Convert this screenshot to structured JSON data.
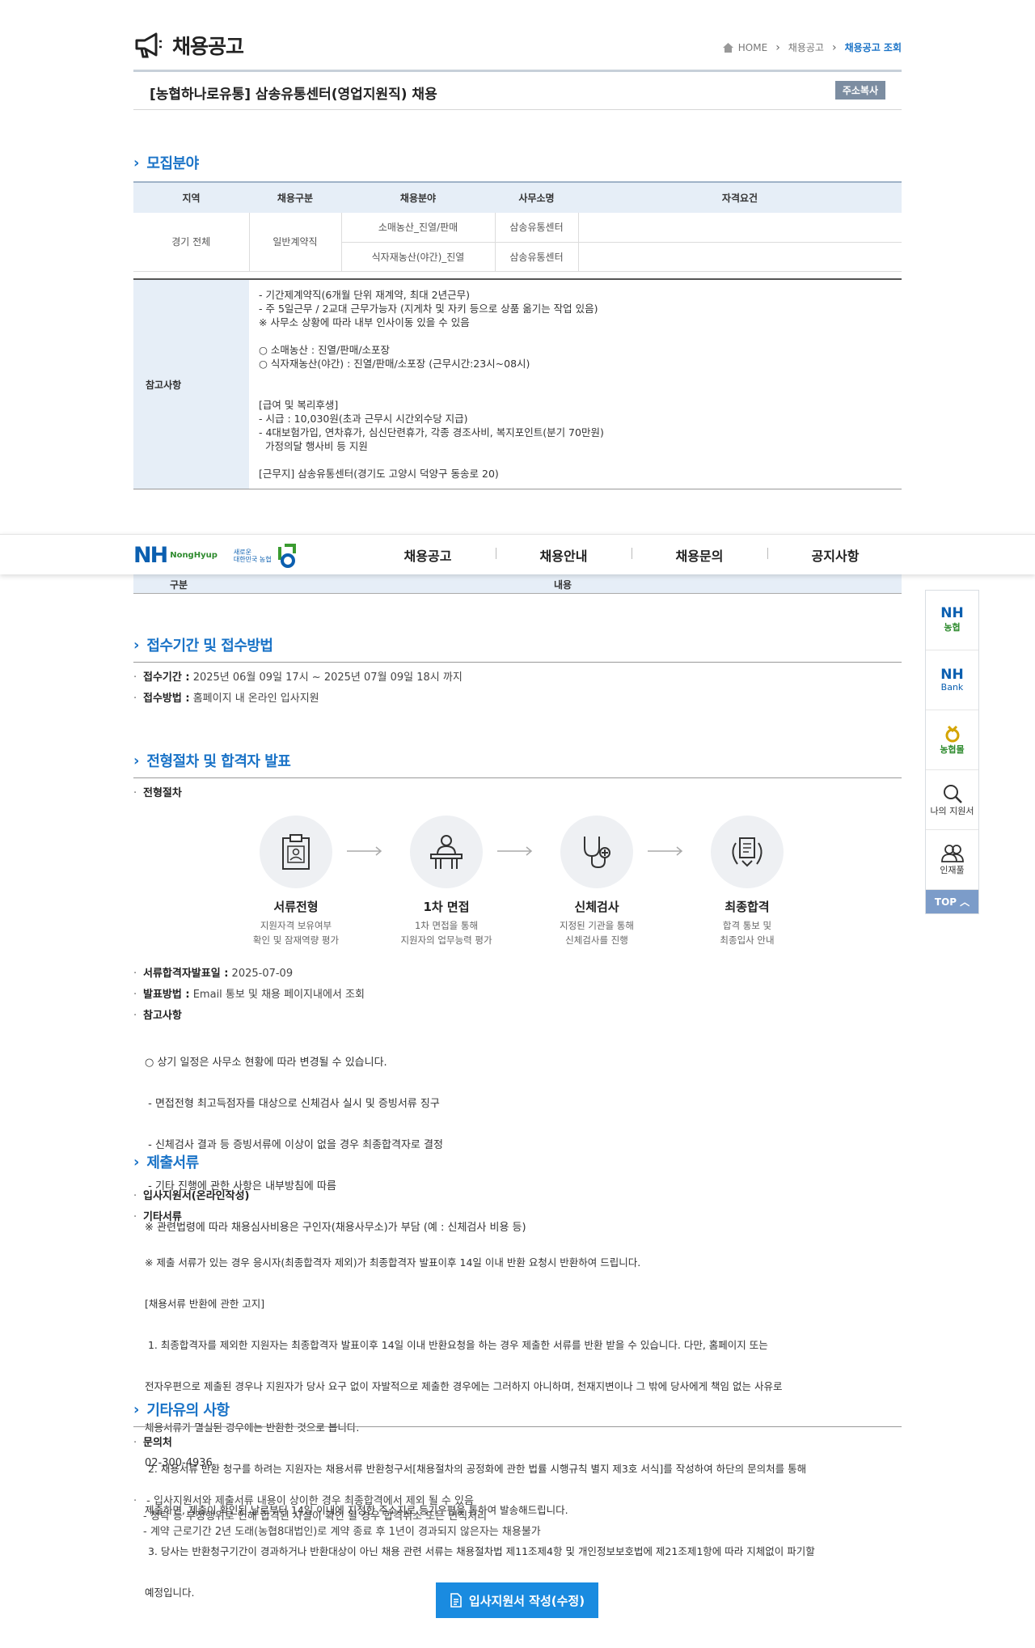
{
  "header": {
    "title": "채용공고",
    "breadcrumb": [
      "HOME",
      "채용공고",
      "채용공고 조회"
    ]
  },
  "job": {
    "title": "[농협하나로유통] 삼송유통센터(영업지원직) 채용",
    "copy_label": "주소복사"
  },
  "recruit": {
    "section_title": "모집분야",
    "columns": [
      "지역",
      "채용구분",
      "채용분야",
      "사무소명",
      "자격요건"
    ],
    "region": "경기 전체",
    "type": "일반계약직",
    "rows": [
      {
        "field": "소매농산_진열/판매",
        "office": "삼송유통센터",
        "qual": ""
      },
      {
        "field": "식자재농산(야간)_진열",
        "office": "삼송유통센터",
        "qual": ""
      }
    ]
  },
  "notes": {
    "label": "참고사항",
    "lines": [
      "- 기간제계약직(6개월 단위 재계약, 최대 2년근무)",
      "- 주 5일근무 / 2교대 근무가능자 (지게차 및 자키 등으로 상품 옮기는 작업 있음)",
      "※ 사무소 상황에 따라 내부 인사이동 있을 수 있음",
      "",
      "○ 소매농산 : 진열/판매/소포장",
      "○ 식자재농산(야간) : 진열/판매/소포장 (근무시간:23시~08시)",
      "",
      "",
      "[급여 및 복리후생]",
      "- 시급 : 10,030원(초과 근무시 시간외수당 지급)",
      "- 4대보험가입, 연차휴가, 심신단련휴가, 각종 경조사비, 복지포인트(분기 70만원)",
      "  가정의달 행사비 등 지원",
      "",
      "[근무지] 삼송유통센터(경기도 고양시 덕양구 동송로 20)"
    ]
  },
  "nav": {
    "logo": "NH",
    "logo_sub": "NongHyup",
    "slogan_1": "새로운",
    "slogan_2": "대한민국 농협",
    "menu": [
      "채용공고",
      "채용안내",
      "채용문의",
      "공지사항"
    ],
    "hidden_left": "구분",
    "hidden_right": "내용"
  },
  "reception": {
    "section_title": "접수기간 및 접수방법",
    "period_label": "접수기간 :",
    "period": "2025년 06월 09일 17시 ~ 2025년 07월 09일 18시 까지",
    "method_label": "접수방법 :",
    "method": "홈페이지 내 온라인 입사지원"
  },
  "process": {
    "section_title": "전형절차 및 합격자 발표",
    "label": "전형절차",
    "steps": [
      {
        "name": "서류전형",
        "desc1": "지원자격 보유여부",
        "desc2": "확인 및 잠재역량 평가"
      },
      {
        "name": "1차 면접",
        "desc1": "1차 면접을 통해",
        "desc2": "지원자의 업무능력 평가"
      },
      {
        "name": "신체검사",
        "desc1": "지정된 기관을 통해",
        "desc2": "신체검사를 진행"
      },
      {
        "name": "최종합격",
        "desc1": "합격 통보 및",
        "desc2": "최종입사 안내"
      }
    ],
    "announce_label": "서류합격자발표일 :",
    "announce": "2025-07-09",
    "method_label": "발표방법 :",
    "method": "Email 통보 및 채용 페이지내에서 조회",
    "notes_label": "참고사항",
    "notes": [
      "○ 상기 일정은 사무소 현황에 따라 변경될 수 있습니다.",
      " - 면접전형 최고득점자를 대상으로 신체검사 실시 및 증빙서류 징구",
      " - 신체검사 결과 등 증빙서류에 이상이 없을 경우 최종합격자로 결정",
      " - 기타 진행에 관한 사항은 내부방침에 따름",
      "※ 관련법령에 따라 채용심사비용은 구인자(채용사무소)가 부담 (예 : 신체검사 비용 등)"
    ]
  },
  "documents": {
    "section_title": "제출서류",
    "item1": "입사지원서(온라인작성)",
    "item2": "기타서류",
    "lines": [
      "※ 제출 서류가 있는 경우 응시자(최종합격자 제외)가 최종합격자 발표이후 14일 이내 반환 요청시 반환하여 드립니다.",
      "[채용서류 반환에 관한 고지]",
      " 1. 최종합격자를 제외한 지원자는 최종합격자 발표이후 14일 이내 반환요청을 하는 경우 제출한 서류를 반환 받을 수 있습니다. 다만, 홈페이지 또는",
      "전자우편으로 제출된 경우나 지원자가 당사 요구 없이 자발적으로 제출한 경우에는 그러하지 아니하며, 천재지변이나 그 밖에 당사에게 책임 없는 사유로",
      "채용서류가 멸실된 경우에는 반환한 것으로 봅니다.",
      " 2. 채용서류 반환 청구를 하려는 지원자는 채용서류 반환청구서[채용절차의 공정화에 관한 법률 시행규칙 별지 제3호 서식]를 작성하여 하단의 문의처를 통해",
      "제출하면, 제출이 확인된 날로부터 14일 이내에 지정한 주소지로 등기우편을 통하여 발송해드립니다.",
      " 3. 당사는 반환청구기간이 경과하거나 반환대상이 아닌 채용 관련 서류는 채용절차법 제11조제4항 및 개인정보보호법에 제21조제1항에 따라 지체없이 파기할",
      "예정입니다."
    ]
  },
  "etc": {
    "section_title": "기타유의 사항",
    "contact_label": "문의처",
    "contact": "02-300-4936",
    "lines": [
      " - 입사지원서와 제출서류 내용이 상이한 경우 최종합격에서 제외 될 수 있음",
      " - 청탁 등 부정행위로 인해 합격된 사실이 확인 될 경우 합격취소 또는 면직처리",
      " - 계약 근로기간 2년 도래(농협8대법인)로 계약 종료 후 1년이 경과되지 않은자는 채용불가"
    ]
  },
  "quick": {
    "items": [
      "NH 농협",
      "NH Bank",
      "농협몰",
      "나의 지원서",
      "인재풀"
    ],
    "nh1_top": "NH",
    "nh1_bot": "농협",
    "nh2_top": "NH",
    "nh2_bot": "Bank",
    "mall": "농협몰",
    "my": "나의 지원서",
    "pool": "인재풀",
    "top": "TOP"
  },
  "apply_label": "입사지원서 작성(수정)",
  "colors": {
    "accent": "#1a73c7",
    "table_head": "#e6eef7",
    "button": "#1a8be0"
  }
}
